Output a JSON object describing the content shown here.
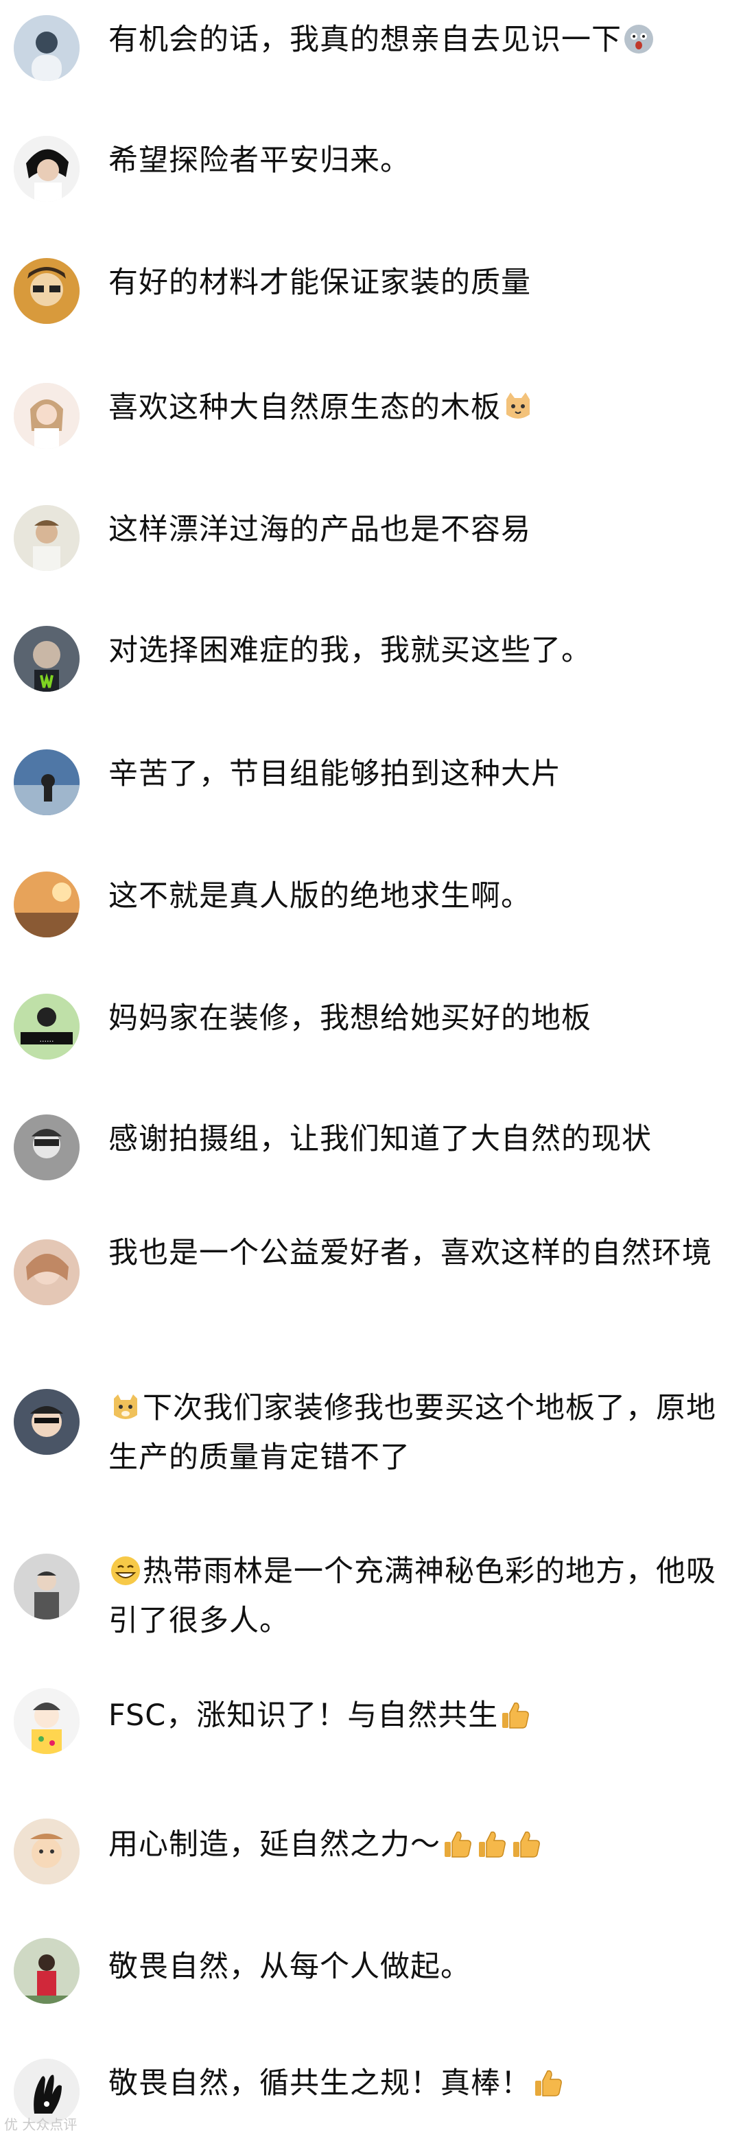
{
  "comments": [
    {
      "text": "有机会的话，我真的想亲自去见识一下",
      "emoji_after": [
        "shocked-face-icon"
      ],
      "emoji_before": []
    },
    {
      "text": "希望探险者平安归来。",
      "emoji_after": [],
      "emoji_before": []
    },
    {
      "text": "有好的材料才能保证家装的质量",
      "emoji_after": [],
      "emoji_before": []
    },
    {
      "text": "喜欢这种大自然原生态的木板",
      "emoji_after": [
        "cat-face-icon"
      ],
      "emoji_before": []
    },
    {
      "text": "这样漂洋过海的产品也是不容易",
      "emoji_after": [],
      "emoji_before": []
    },
    {
      "text": "对选择困难症的我，我就买这些了。",
      "emoji_after": [],
      "emoji_before": []
    },
    {
      "text": "辛苦了，节目组能够拍到这种大片",
      "emoji_after": [],
      "emoji_before": []
    },
    {
      "text": "这不就是真人版的绝地求生啊。",
      "emoji_after": [],
      "emoji_before": []
    },
    {
      "text": "妈妈家在装修，我想给她买好的地板",
      "emoji_after": [],
      "emoji_before": []
    },
    {
      "text": "感谢拍摄组，让我们知道了大自然的现状",
      "emoji_after": [],
      "emoji_before": []
    },
    {
      "text": "我也是一个公益爱好者，喜欢这样的自然环境",
      "emoji_after": [],
      "emoji_before": []
    },
    {
      "text": "下次我们家装修我也要买这个地板了，原地生产的质量肯定错不了",
      "emoji_after": [],
      "emoji_before": [
        "doge-icon"
      ]
    },
    {
      "text": "热带雨林是一个充满神秘色彩的地方，他吸引了很多人。",
      "emoji_after": [],
      "emoji_before": [
        "grin-face-icon"
      ]
    },
    {
      "text": "FSC，涨知识了！与自然共生",
      "emoji_after": [
        "thumbs-up-icon"
      ],
      "emoji_before": []
    },
    {
      "text": "用心制造，延自然之力～",
      "emoji_after": [
        "thumbs-up-icon",
        "thumbs-up-icon",
        "thumbs-up-icon"
      ],
      "emoji_before": []
    },
    {
      "text": "敬畏自然，从每个人做起。",
      "emoji_after": [],
      "emoji_before": []
    },
    {
      "text": "敬畏自然，循共生之规！真棒！",
      "emoji_after": [
        "thumbs-up-icon"
      ],
      "emoji_before": []
    }
  ],
  "watermark": "优 大众点评",
  "colors": {
    "text": "#111111",
    "background": "#ffffff",
    "thumb": "#f5b84a",
    "face": "#f7c948"
  }
}
